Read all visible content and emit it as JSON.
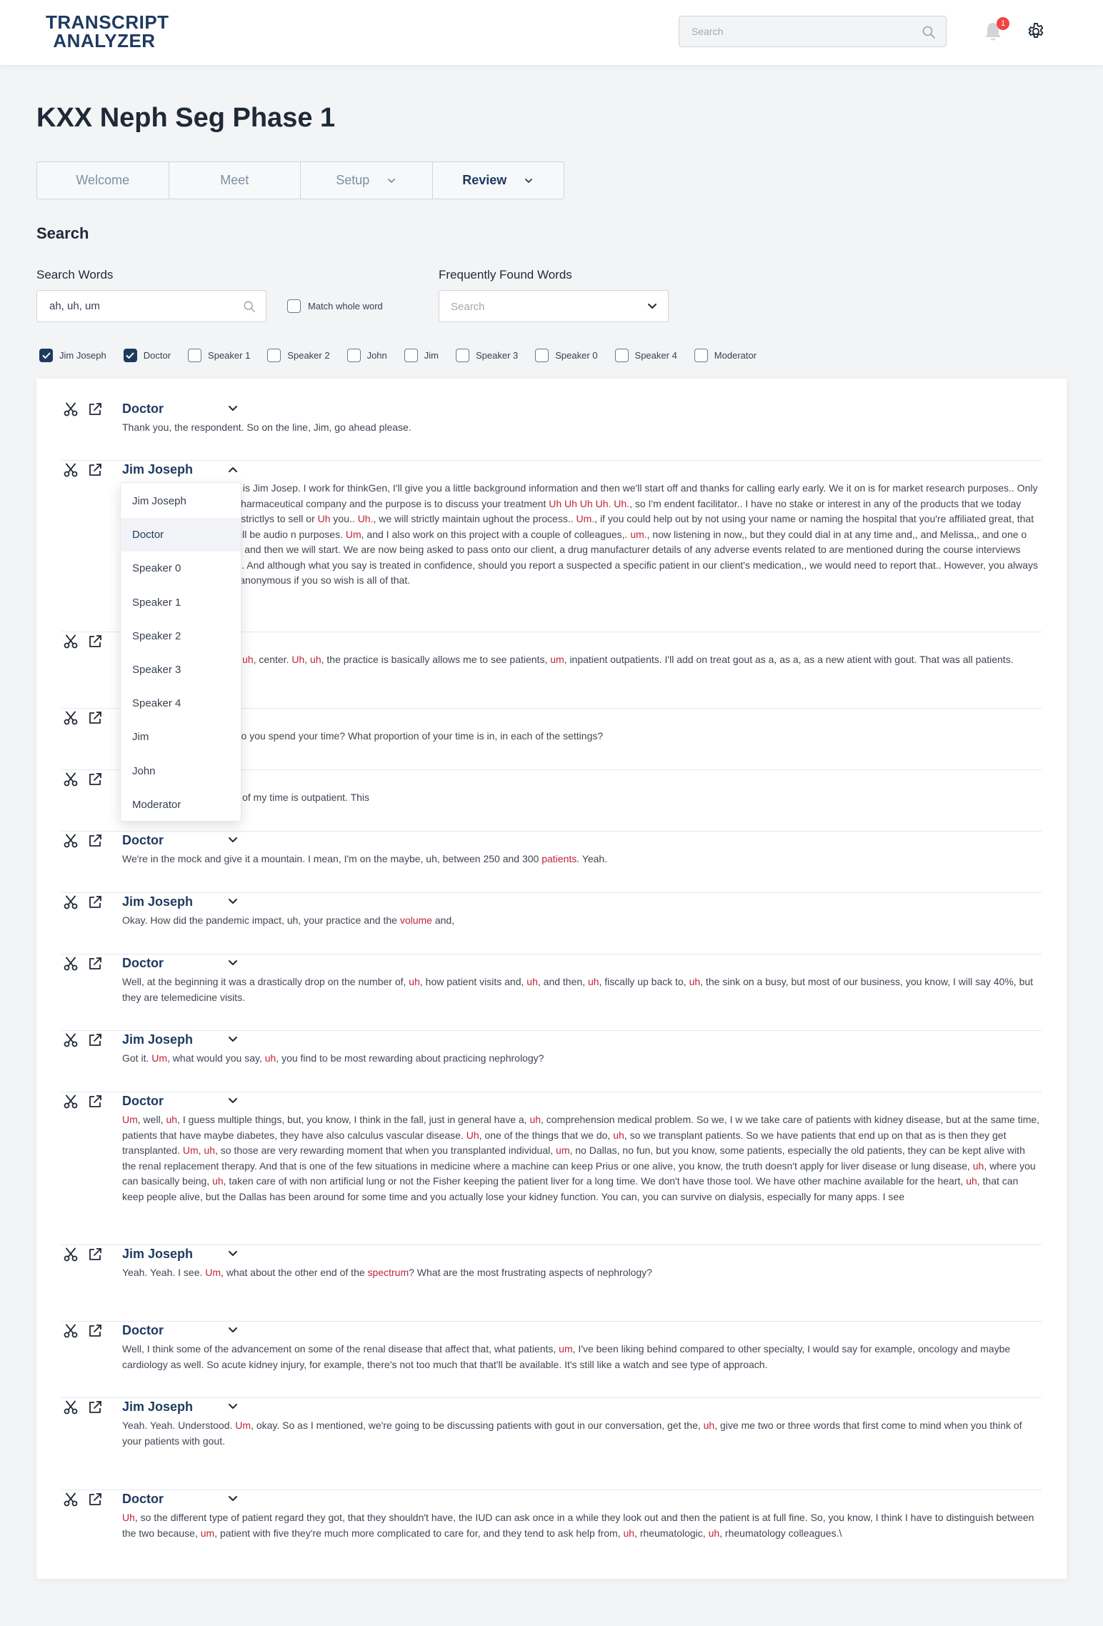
{
  "header": {
    "logo_line1": "TRANSCRIPT",
    "logo_line2": "ANALYZER",
    "search_placeholder": "Search",
    "notification_count": "1"
  },
  "page": {
    "title": "KXX Neph Seg Phase 1",
    "tabs": [
      {
        "label": "Welcome"
      },
      {
        "label": "Meet"
      },
      {
        "label": "Setup"
      },
      {
        "label": "Review"
      }
    ],
    "active_tab": "Review"
  },
  "search": {
    "title": "Search",
    "words_label": "Search Words",
    "words_value": "ah, uh, um",
    "match_whole_label": "Match whole word",
    "match_whole_checked": false,
    "freq_label": "Frequently Found Words",
    "freq_placeholder": "Search"
  },
  "speaker_filters": [
    {
      "label": "Jim Joseph",
      "checked": true
    },
    {
      "label": "Doctor",
      "checked": true
    },
    {
      "label": "Speaker 1",
      "checked": false
    },
    {
      "label": "Speaker 2",
      "checked": false
    },
    {
      "label": "John",
      "checked": false
    },
    {
      "label": "Jim",
      "checked": false
    },
    {
      "label": "Speaker 3",
      "checked": false
    },
    {
      "label": "Speaker 0",
      "checked": false
    },
    {
      "label": "Speaker 4",
      "checked": false
    },
    {
      "label": "Moderator",
      "checked": false
    }
  ],
  "dropdown": {
    "items": [
      "Jim Joseph",
      "Doctor",
      "Speaker 0",
      "Speaker 1",
      "Speaker 2",
      "Speaker 3",
      "Speaker 4",
      "Jim",
      "John",
      "Moderator"
    ],
    "selected": "Doctor"
  },
  "entries": [
    {
      "speaker": "Doctor",
      "text": "Thank you, the respondent. So on the line, Jim, go ahead please."
    },
    {
      "speaker": "Jim Joseph",
      "expanded": true,
      "text": "u so much forus. My name is Jim Josep. I work for thinkGen, I'll give you a little background information and then we'll start off and thanks for calling early early. We it on is for market research purposes.. Only it's being sponsored by a pharmaceutical company and the purpose is to discuss your treatment [Uh Uh Uh Uh. Uh.], so I'm endent facilitator.. I have no stake or interest in any of the products that we today discuss today,, and [Uh Uh] strictlys to sell or [Uh] you.. [Uh.], we will strictly maintain ughout the process.. [Um.], if you could help out by not using your name or naming the hospital that you're affiliated great, that would be great.. [Uh.], we will be audio n purposes. [Um], and I also work on this project with a couple of colleagues,. [um.], now listening in now,, but they could dial in at any time and,, and Melissa,, and one o events on adverse events,, and then we will start. We are now being asked to pass onto our client, a drug manufacturer details of any adverse events related to are mentioned during the course interviews market research interviews. And although what you say is treated in confidence, should you report a suspected a specific patient in our client's medication,, we would need to report that.. However, you always have the choice to remain anonymous if you so wish is all of that."
    },
    {
      "speaker": "",
      "text": "m walking in on academic, [uh], center. [Uh], [uh], the practice is basically allows me to see patients, [um], inpatient outpatients. I'll add on treat gout as a, as a, as a new atient with gout. That was all patients."
    },
    {
      "speaker": "",
      "text": "o just an estimate of how do you spend your time? What proportion of your time is in, in each of the settings?"
    },
    {
      "speaker": "",
      "text": "ny dying patients and 30% of my time is outpatient. This"
    },
    {
      "speaker": "Doctor",
      "text": "We're in the mock and give it a mountain. I mean, I'm on the maybe, uh, between 250 and 300 [patients]. Yeah."
    },
    {
      "speaker": "Jim Joseph",
      "text": "Okay. How did the pandemic impact, uh, your practice and the [volume] and,"
    },
    {
      "speaker": "Doctor",
      "text": "Well, at the beginning it was a drastically drop on the number of, [uh], how patient visits and, [uh], and then, [uh], fiscally up back to, [uh], the sink on a busy, but most of our business, you know, I will say 40%, but they are telemedicine visits."
    },
    {
      "speaker": "Jim Joseph",
      "text": "Got it. [Um], what would you say, [uh], you find to be most rewarding about practicing nephrology?"
    },
    {
      "speaker": "Doctor",
      "text": "[Um], well, [uh], I guess multiple things, but, you know, I think in the fall, just in general have a, [uh], comprehension medical problem. So we, I w we take care of patients with kidney disease, but at the same time, patients that have maybe diabetes, they have also calculus vascular disease. [Uh], one of the things that we do, [uh], so we transplant patients. So we have patients that end up on that as is then they get transplanted. [Um], [uh], so those are very rewarding moment that when you transplanted individual, [um], no Dallas, no fun, but you know, some patients, especially the old patients, they can be kept alive with the renal replacement therapy. And that is one of the few situations in medicine where a machine can keep Prius or one alive, you know, the truth doesn't apply for liver disease or lung disease, [uh], where you can basically being, [uh], taken care of with non artificial lung or not the Fisher keeping the patient liver for a long time. We don't have those tool. We have other machine available for the heart, [uh], that can keep people alive, but the Dallas has been around for some time and you actually lose your kidney function. You can, you can survive on dialysis, especially for many apps. I see"
    },
    {
      "speaker": "Jim Joseph",
      "text": "Yeah. Yeah. I see. [Um], what about the other end of the [spectrum]? What are the most frustrating aspects of nephrology?"
    },
    {
      "speaker": "Doctor",
      "text": "Well, I think some of the advancement on some of the renal disease that affect that, what patients, [um], I've been liking behind compared to other specialty, I would say for example, oncology and maybe cardiology as well. So acute kidney injury, for example, there's not too much that that'll be available. It's still like a watch and see type of approach."
    },
    {
      "speaker": "Jim Joseph",
      "text": "Yeah. Yeah. Understood. [Um], okay. So as I mentioned, we're going to be discussing patients with gout in our conversation, get the, [uh], give me two or three words that first come to mind when you think of your patients with gout."
    },
    {
      "speaker": "Doctor",
      "text": "[Uh], so the different type of patient regard they got, that they shouldn't have, the IUD can ask once in a while they look out and then the patient is at full fine. So, you know, I think I have to distinguish between the two because, [um], patient with five they're much more complicated to care for, and they tend to ask help from, [uh], rheumatologic, [uh], rheumatology colleagues.\\"
    }
  ]
}
